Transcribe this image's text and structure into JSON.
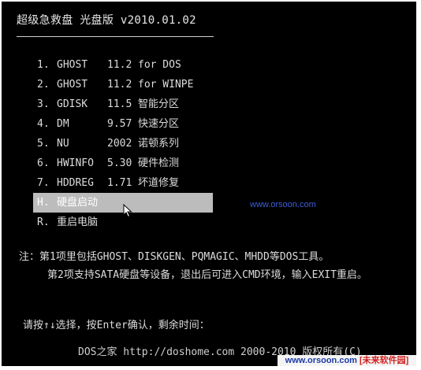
{
  "header": {
    "title": "超级急救盘 光盘版 v2010.01.02"
  },
  "menu": {
    "items": [
      {
        "key": "1.",
        "name": "GHOST",
        "version": "11.2",
        "desc": "for DOS"
      },
      {
        "key": "2.",
        "name": "GHOST",
        "version": "11.2",
        "desc": "for WINPE"
      },
      {
        "key": "3.",
        "name": "GDISK",
        "version": "11.5",
        "desc": "智能分区"
      },
      {
        "key": "4.",
        "name": "DM",
        "version": "9.57",
        "desc": "快速分区"
      },
      {
        "key": "5.",
        "name": "NU",
        "version": "2002",
        "desc": "诺顿系列"
      },
      {
        "key": "6.",
        "name": "HWINFO",
        "version": "5.30",
        "desc": "硬件检测"
      },
      {
        "key": "7.",
        "name": "HDDREG",
        "version": "1.71",
        "desc": "坏道修复"
      },
      {
        "key": "H.",
        "name": "硬盘启动",
        "version": "",
        "desc": ""
      },
      {
        "key": "R.",
        "name": "重启电脑",
        "version": "",
        "desc": ""
      }
    ],
    "selected_index": 7
  },
  "notes": {
    "line1": "注：第1项里包括GHOST、DISKGEN、PQMAGIC、MHDD等DOS工具。",
    "line2": "第2项支持SATA硬盘等设备，退出后可进入CMD环境，输入EXIT重启。"
  },
  "prompt": "请按↑↓选择，按Enter确认，剩余时间：",
  "footer": "DOS之家 http://doshome.com 2000-2010 版权所有(C)",
  "watermarks": {
    "site": "www.orsoon.com",
    "badge_url": "www.orsoon.com",
    "badge_label": "[未来软件园]"
  },
  "icons": {
    "cursor": "mouse-pointer-icon"
  },
  "colors": {
    "background": "#000000",
    "text": "#dcdcdc",
    "selection": "#bcbcbc",
    "watermark_blue": "#3d5fd6"
  }
}
